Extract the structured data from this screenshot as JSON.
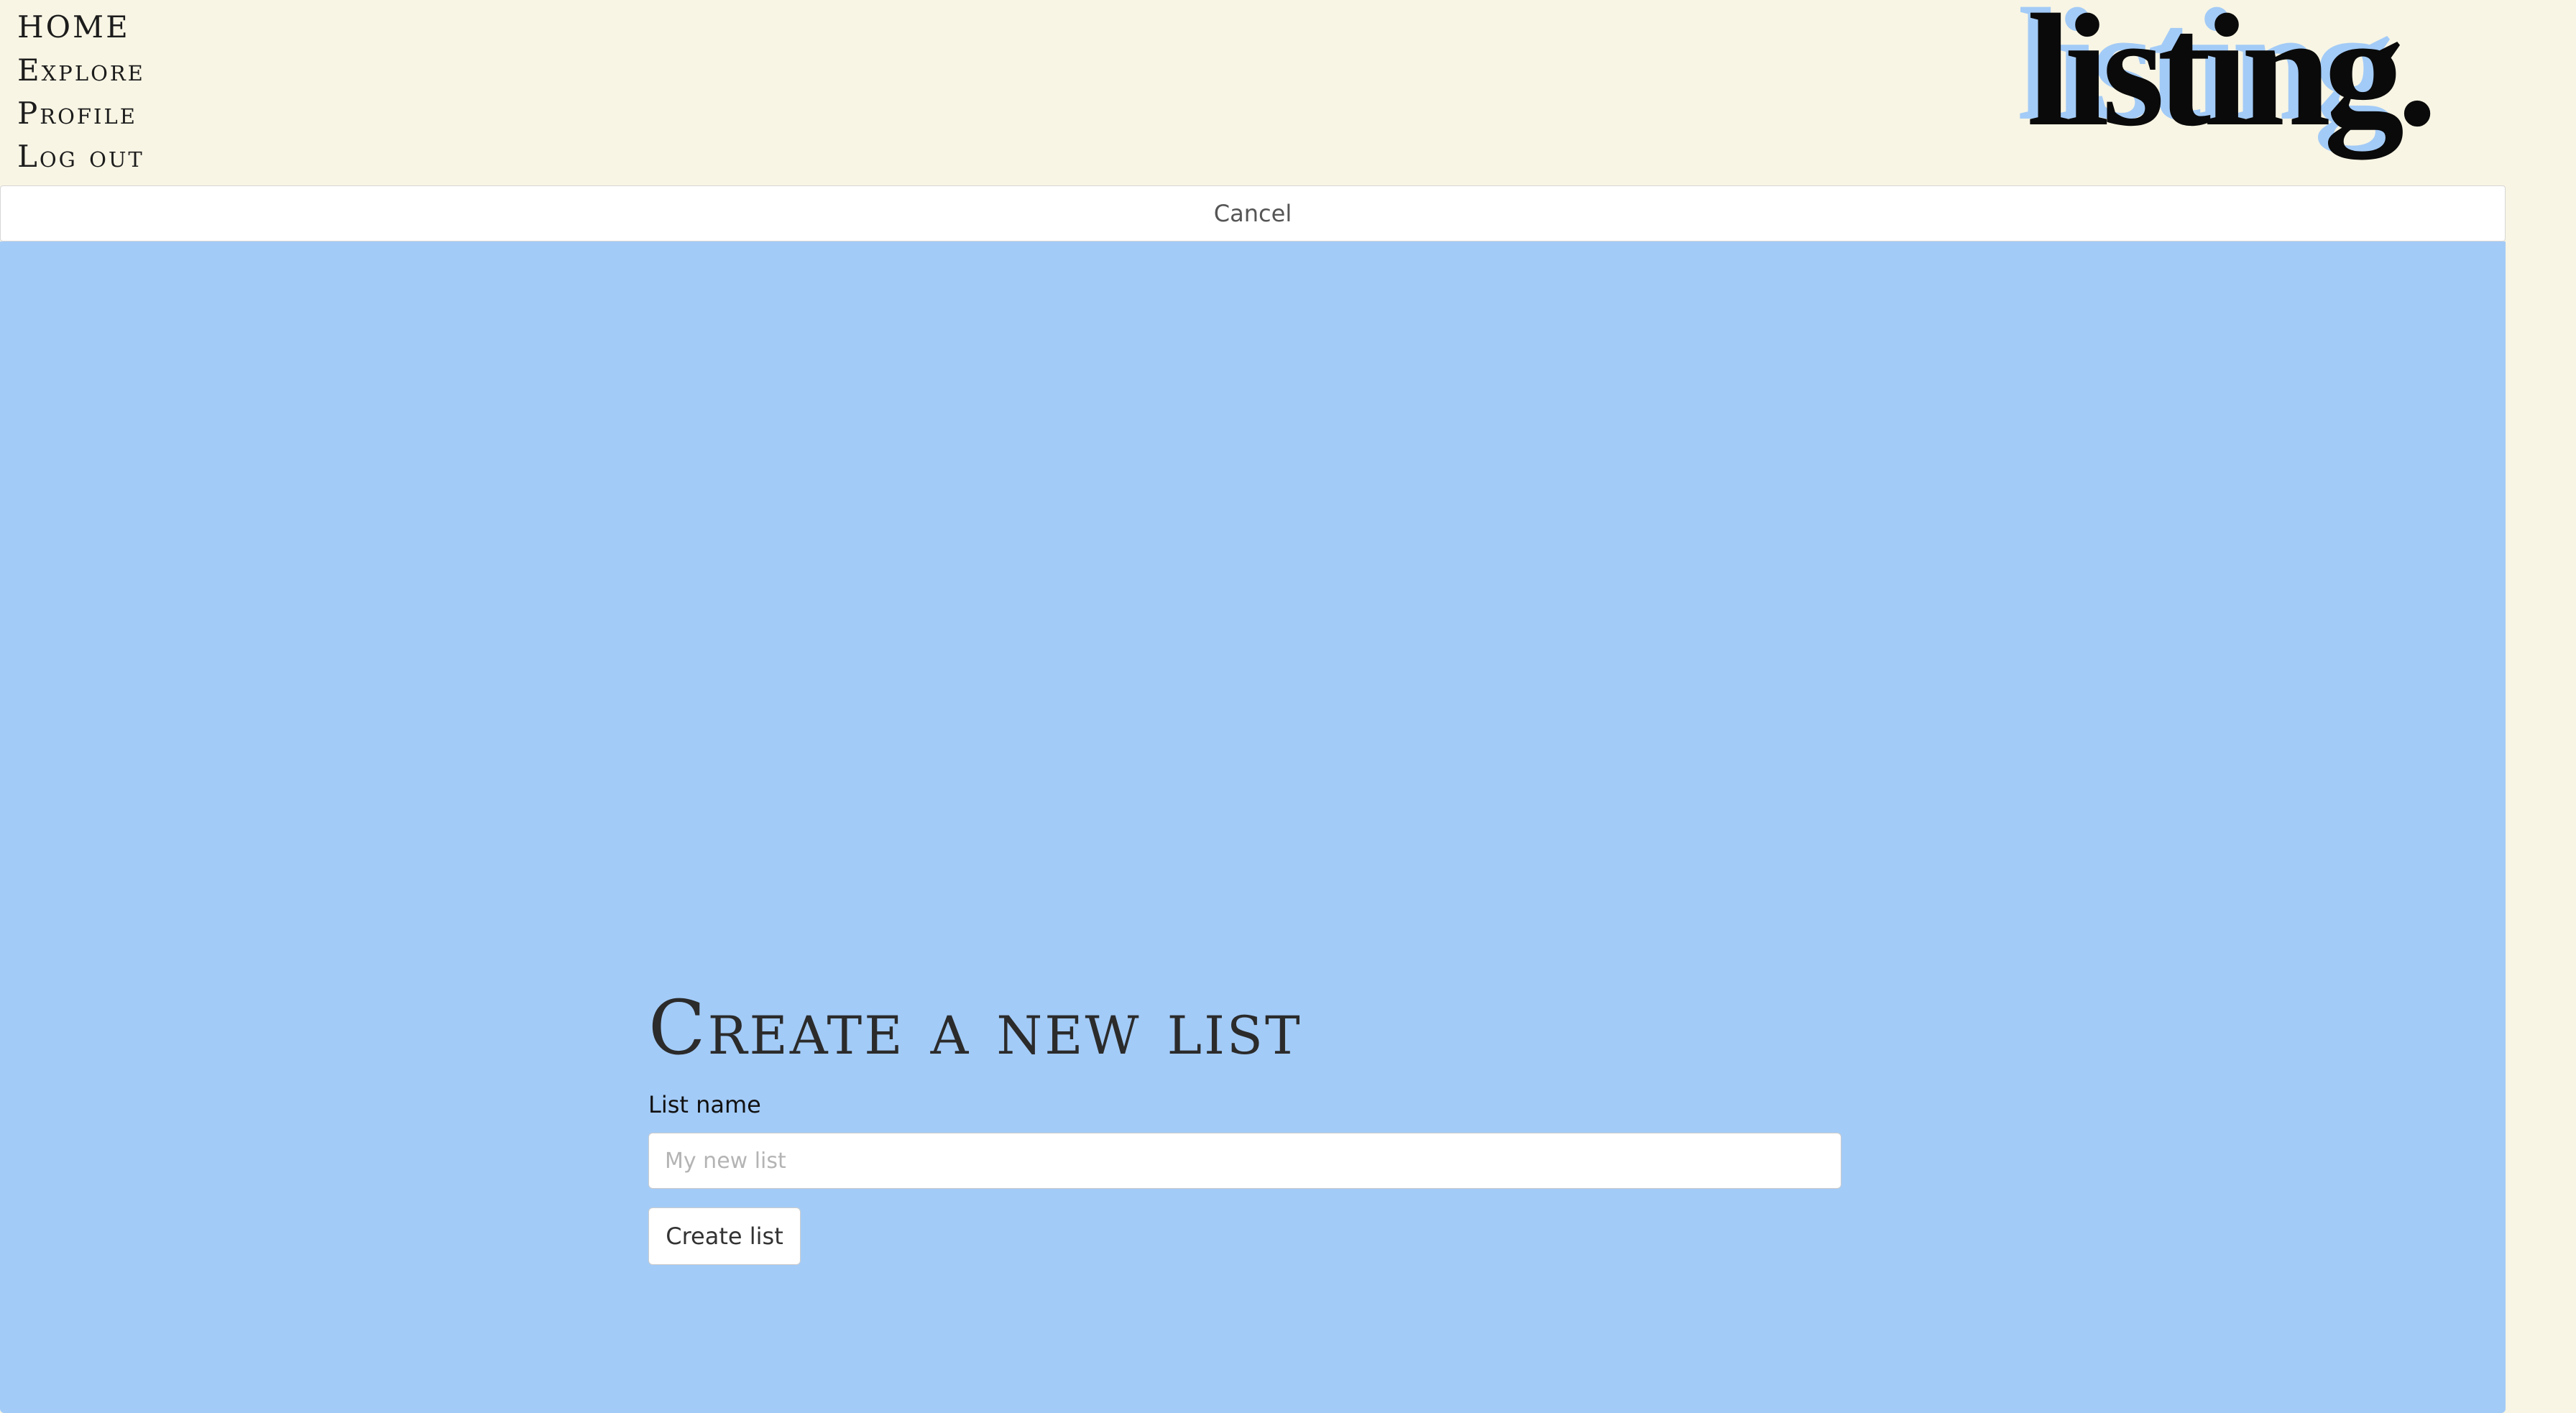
{
  "nav": {
    "items": [
      {
        "label": "HOME"
      },
      {
        "label": "Explore"
      },
      {
        "label": "Profile"
      },
      {
        "label": "Log out"
      }
    ]
  },
  "logo": {
    "text": "listing",
    "dot": "."
  },
  "cancel": {
    "label": "Cancel"
  },
  "form": {
    "title": "Create a new list",
    "list_name_label": "List name",
    "list_name_value": "",
    "list_name_placeholder": "My new list",
    "submit_label": "Create list"
  },
  "colors": {
    "page_background": "#f8f5e4",
    "panel_background": "#a3cbf7",
    "logo_shadow": "#a3cbf7",
    "text_dark": "#1c1c1c"
  }
}
